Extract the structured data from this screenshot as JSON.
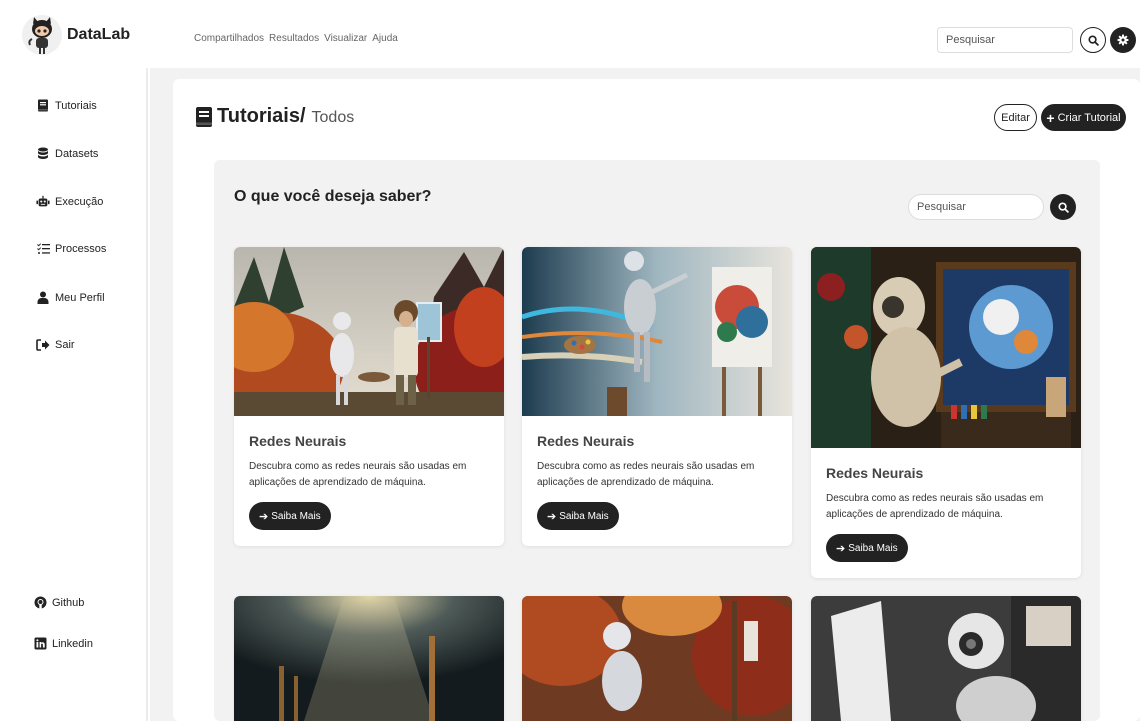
{
  "brand": {
    "name": "DataLab"
  },
  "topnav": {
    "items": [
      "Compartilhados",
      "Resultados",
      "Visualizar",
      "Ajuda"
    ]
  },
  "top_search": {
    "placeholder": "Pesquisar"
  },
  "sidebar": {
    "items": [
      {
        "label": "Tutoriais",
        "icon": "book-icon"
      },
      {
        "label": "Datasets",
        "icon": "database-icon"
      },
      {
        "label": "Execução",
        "icon": "robot-icon"
      },
      {
        "label": "Processos",
        "icon": "list-check-icon"
      },
      {
        "label": "Meu Perfil",
        "icon": "user-icon"
      },
      {
        "label": "Sair",
        "icon": "sign-out-icon"
      }
    ],
    "footer": [
      {
        "label": "Github",
        "icon": "github-icon"
      },
      {
        "label": "Linkedin",
        "icon": "linkedin-icon"
      }
    ]
  },
  "page": {
    "title": "Tutoriais/",
    "subtitle": "Todos",
    "edit_label": "Editar",
    "create_label": "Criar Tutorial"
  },
  "section": {
    "question": "O que você deseja saber?",
    "search_placeholder": "Pesquisar"
  },
  "cards": [
    {
      "title": "Redes Neurais",
      "description": "Descubra como as redes neurais são usadas em aplicações de aprendizado de máquina.",
      "button": "Saiba Mais"
    },
    {
      "title": "Redes Neurais",
      "description": "Descubra como as redes neurais são usadas em aplicações de aprendizado de máquina.",
      "button": "Saiba Mais"
    },
    {
      "title": "Redes Neurais",
      "description": "Descubra como as redes neurais são usadas em aplicações de aprendizado de máquina.",
      "button": "Saiba Mais"
    }
  ],
  "colors": {
    "dark": "#222222",
    "panel_bg": "#f2f2f2"
  }
}
